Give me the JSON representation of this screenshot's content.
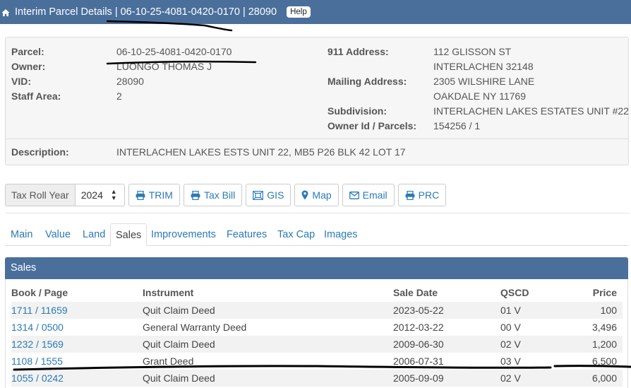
{
  "header": {
    "title": "Interim Parcel Details | 06-10-25-4081-0420-0170 | 28090",
    "help_label": "Help",
    "home_icon": "home-icon"
  },
  "details": {
    "left": [
      {
        "label": "Parcel:",
        "value": "06-10-25-4081-0420-0170"
      },
      {
        "label": "Owner:",
        "value": "LUONGO THOMAS J"
      },
      {
        "label": "VID:",
        "value": "28090"
      },
      {
        "label": "Staff Area:",
        "value": "2"
      }
    ],
    "right": [
      {
        "label": "911 Address:",
        "value": "112 GLISSON ST"
      },
      {
        "label": "",
        "value": "INTERLACHEN 32148"
      },
      {
        "label": "Mailing Address:",
        "value": "2305 WILSHIRE LANE"
      },
      {
        "label": "",
        "value": "OAKDALE NY 11769"
      },
      {
        "label": "Subdivision:",
        "value": "INTERLACHEN LAKES ESTATES UNIT #22"
      },
      {
        "label": "Owner Id / Parcels:",
        "value": "154256 / 1"
      }
    ],
    "description_label": "Description:",
    "description_value": "INTERLACHEN LAKES ESTS UNIT 22, MB5 P26 BLK 42 LOT 17"
  },
  "toolbar": {
    "tax_roll_label": "Tax Roll Year",
    "tax_roll_value": "2024",
    "buttons": [
      {
        "label": "TRIM",
        "icon": "print-icon"
      },
      {
        "label": "Tax Bill",
        "icon": "print-icon"
      },
      {
        "label": "GIS",
        "icon": "gis-icon"
      },
      {
        "label": "Map",
        "icon": "map-marker-icon"
      },
      {
        "label": "Email",
        "icon": "envelope-icon"
      },
      {
        "label": "PRC",
        "icon": "print-icon"
      }
    ]
  },
  "tabs": [
    {
      "label": "Main",
      "active": false
    },
    {
      "label": "Value",
      "active": false
    },
    {
      "label": "Land",
      "active": false
    },
    {
      "label": "Sales",
      "active": true
    },
    {
      "label": "Improvements",
      "active": false
    },
    {
      "label": "Features",
      "active": false
    },
    {
      "label": "Tax Cap",
      "active": false
    },
    {
      "label": "Images",
      "active": false
    }
  ],
  "sales": {
    "title": "Sales",
    "columns": [
      "Book / Page",
      "Instrument",
      "Sale Date",
      "QSCD",
      "Price"
    ],
    "rows": [
      {
        "book_page": "1711 / 11659",
        "instrument": "Quit Claim Deed",
        "sale_date": "2023-05-22",
        "qscd": "01  V",
        "price": "100"
      },
      {
        "book_page": "1314 / 0500",
        "instrument": "General Warranty Deed",
        "sale_date": "2012-03-22",
        "qscd": "00  V",
        "price": "3,496"
      },
      {
        "book_page": "1232 / 1569",
        "instrument": "Quit Claim Deed",
        "sale_date": "2009-06-30",
        "qscd": "02  V",
        "price": "1,200"
      },
      {
        "book_page": "1108 / 1555",
        "instrument": "Grant Deed",
        "sale_date": "2006-07-31",
        "qscd": "03  V",
        "price": "6,500"
      },
      {
        "book_page": "1055 / 0242",
        "instrument": "Quit Claim Deed",
        "sale_date": "2005-09-09",
        "qscd": "02  V",
        "price": "6,000"
      }
    ]
  },
  "colors": {
    "header_bg": "#4a6f9b",
    "link": "#2a7ab8",
    "panel_bg": "#f6f6f6"
  }
}
